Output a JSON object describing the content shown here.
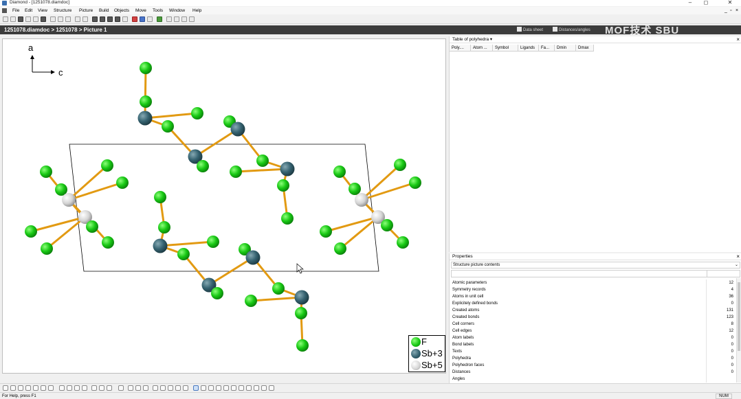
{
  "window": {
    "title": "Diamond - [1251078.diamdoc]",
    "minimize": "–",
    "maximize": "◻",
    "close": "✕"
  },
  "menu": {
    "items": [
      "File",
      "Edit",
      "View",
      "Structure",
      "Picture",
      "Build",
      "Objects",
      "Move",
      "Tools",
      "Window",
      "Help"
    ],
    "mdi_minimize": "_",
    "mdi_restore": "▫",
    "mdi_close": "×"
  },
  "document": {
    "breadcrumb": "1251078.diamdoc > 1251078 > Picture 1",
    "tabs": [
      "Data sheet",
      "Distances/angles"
    ]
  },
  "watermark": "MOF技术 SBU",
  "axes": {
    "vertical": "a",
    "horizontal": "c"
  },
  "legend": [
    {
      "label": "F",
      "color": "#1ec81e"
    },
    {
      "label": "Sb+3",
      "color": "#3d6d7a"
    },
    {
      "label": "Sb+5",
      "color": "#d8d8d8"
    }
  ],
  "polyhedra_panel": {
    "title": "Table of polyhedra",
    "columns": [
      "Poly....",
      "Atom ...",
      "Symbol",
      "Ligands",
      "Fa...",
      "Dmin",
      "Dmax"
    ]
  },
  "properties_panel": {
    "title": "Properties",
    "selector": "Structure picture contents",
    "rows": [
      {
        "name": "Atomic parameters",
        "value": "12"
      },
      {
        "name": "Symmetry records",
        "value": "4"
      },
      {
        "name": "Atoms in unit cell",
        "value": "36"
      },
      {
        "name": "Explicitely defined bonds",
        "value": "0"
      },
      {
        "name": "Created atoms",
        "value": "131"
      },
      {
        "name": "Created bonds",
        "value": "123"
      },
      {
        "name": "Cell corners",
        "value": "8"
      },
      {
        "name": "Cell edges",
        "value": "12"
      },
      {
        "name": "Atom labels",
        "value": "0"
      },
      {
        "name": "Bond labels",
        "value": "0"
      },
      {
        "name": "Texts",
        "value": "0"
      },
      {
        "name": "Polyhedra",
        "value": "0"
      },
      {
        "name": "Polyhedron faces",
        "value": "0"
      },
      {
        "name": "Distances",
        "value": "0"
      },
      {
        "name": "Angles",
        "value": ""
      }
    ]
  },
  "statusbar": {
    "hint": "For Help, press F1",
    "num": "NUM"
  },
  "colors": {
    "fluorine": "#1ec81e",
    "sb3": "#3d6d7a",
    "sb5": "#d8d8d8",
    "bond": "#e29a12"
  }
}
